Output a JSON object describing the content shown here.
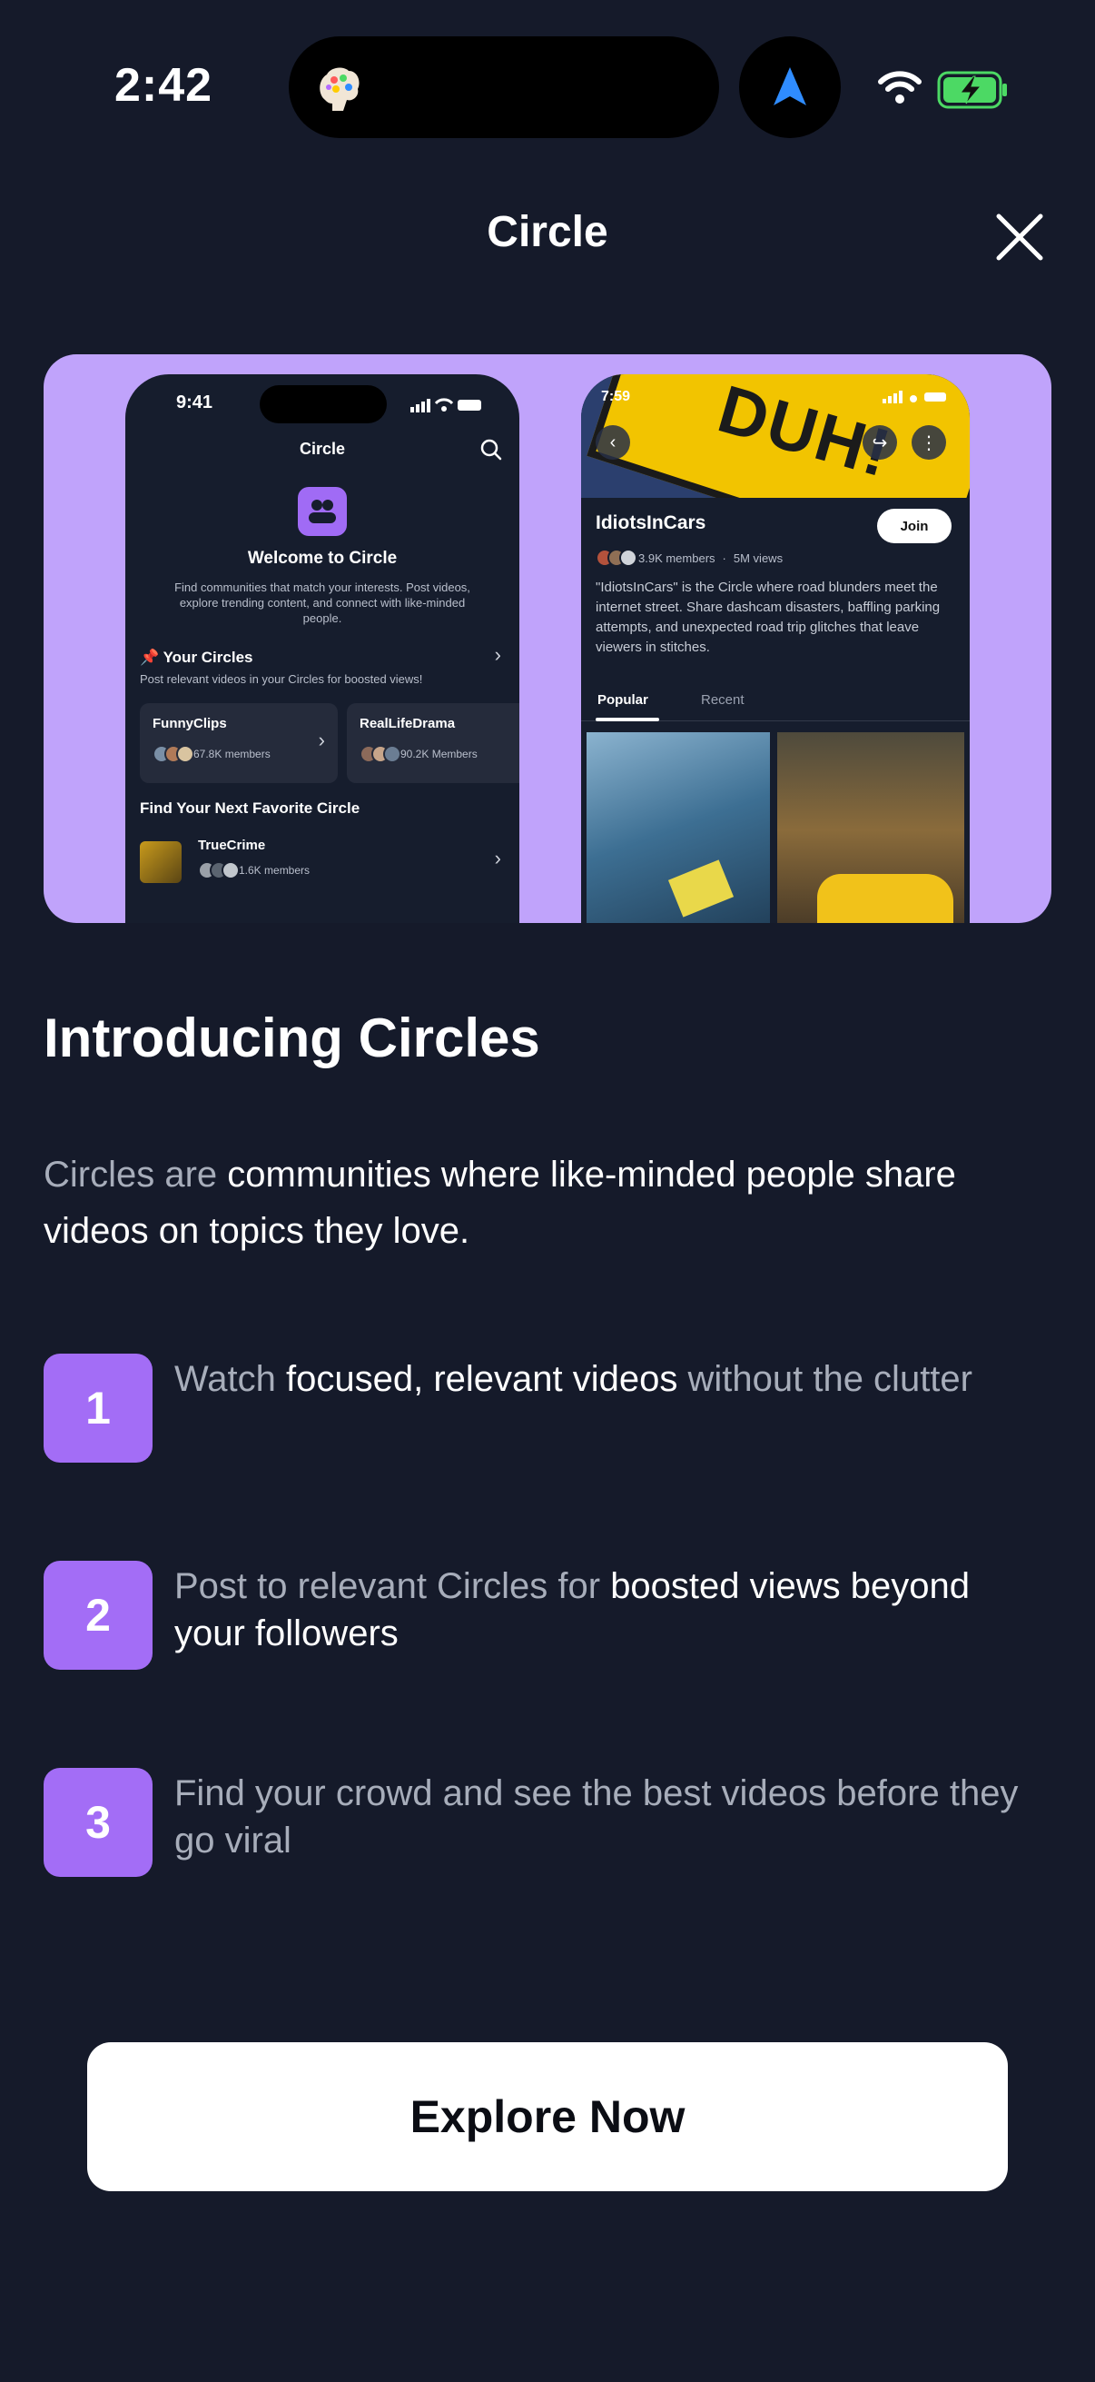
{
  "status_bar": {
    "time": "2:42"
  },
  "header": {
    "title": "Circle"
  },
  "hero": {
    "left_phone": {
      "time": "9:41",
      "title": "Circle",
      "welcome": "Welcome to Circle",
      "description": "Find communities that match your interests. Post videos, explore trending content, and connect with like-minded people.",
      "your_circles": "Your Circles",
      "your_circles_sub": "Post relevant videos in your Circles for boosted views!",
      "cards": [
        {
          "name": "FunnyClips",
          "members": "67.8K members"
        },
        {
          "name": "RealLifeDrama",
          "members": "90.2K Members"
        }
      ],
      "find_next": "Find Your Next Favorite Circle",
      "suggested": {
        "name": "TrueCrime",
        "members": "1.6K members"
      }
    },
    "right_phone": {
      "time": "7:59",
      "banner_text": "DUH!",
      "circle_name": "IdiotsInCars",
      "join": "Join",
      "members": "3.9K members",
      "views": "5M views",
      "description": "\"IdiotsInCars\" is the Circle where road blunders meet the internet street. Share dashcam disasters, baffling parking attempts, and unexpected road trip glitches that leave viewers in stitches.",
      "tabs": [
        "Popular",
        "Recent"
      ]
    }
  },
  "intro": {
    "title": "Introducing Circles",
    "desc_muted": "Circles are ",
    "desc_strong": "communities where like-minded people share videos on topics they love."
  },
  "steps": [
    {
      "number": "1",
      "pre": "Watch ",
      "strong": "focused, relevant videos",
      "post": " without the clutter"
    },
    {
      "number": "2",
      "pre": "Post to relevant Circles for ",
      "strong": "boosted views beyond your followers",
      "post": ""
    },
    {
      "number": "3",
      "pre": "Find your crowd and see the best videos before they go viral",
      "strong": "",
      "post": ""
    }
  ],
  "cta": {
    "label": "Explore Now"
  },
  "colors": {
    "background": "#151a2a",
    "accent": "#a36df6",
    "hero_bg": "#c0a3fb",
    "battery_green": "#4cd964",
    "nav_arrow": "#2f8cff"
  }
}
